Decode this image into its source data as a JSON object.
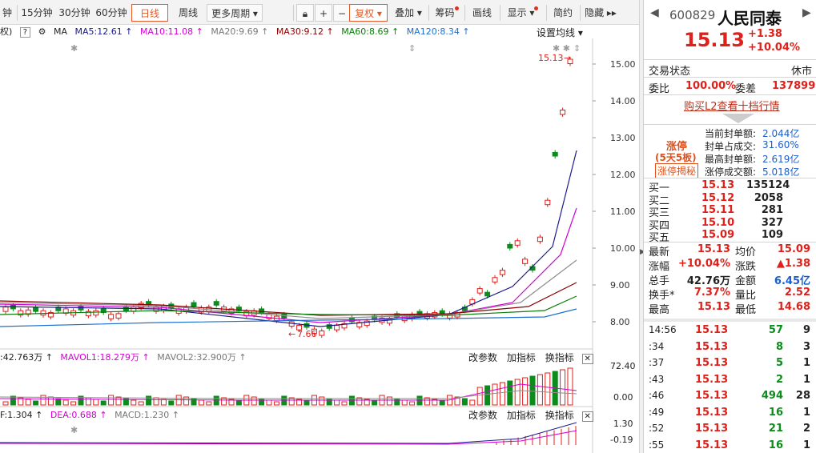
{
  "toolbar": {
    "items": [
      "钟",
      "15分钟",
      "30分钟",
      "60分钟",
      "日线",
      "周线",
      "更多周期 ▾"
    ],
    "icons": [
      "lock-icon",
      "zoom-in-icon",
      "zoom-out-icon"
    ],
    "right_items": [
      "复权 ▾",
      "叠加 ▾",
      "筹码",
      "画线",
      "显示 ▾",
      "简约",
      "隐藏 ▸▸"
    ]
  },
  "ma_bar": {
    "prefix": "权)",
    "ma_label": "MA",
    "ma5": "MA5:12.61 ↑",
    "ma10": "MA10:11.08 ↑",
    "ma20": "MA20:9.69 ↑",
    "ma30": "MA30:9.12 ↑",
    "ma60": "MA60:8.69 ↑",
    "ma120": "MA120:8.34 ↑",
    "settings": "设置均线 ▾"
  },
  "price_axis": [
    "15.00",
    "14.00",
    "13.00",
    "12.00",
    "11.00",
    "10.00",
    "9.00",
    "8.00"
  ],
  "annotations": {
    "high": "15.13",
    "low": "7.66"
  },
  "vol_bar": {
    "v1": ":42.763万 ↑",
    "mavol1": "MAVOL1:18.279万 ↑",
    "mavol2": "MAVOL2:32.900万 ↑",
    "btn1": "改参数",
    "btn2": "加指标",
    "btn3": "换指标",
    "axis_top": "72.40",
    "axis_bottom": "0.00"
  },
  "macd_bar": {
    "dif": "F:1.304 ↑",
    "dea": "DEA:0.688 ↑",
    "macd": "MACD:1.230 ↑",
    "btn1": "改参数",
    "btn2": "加指标",
    "btn3": "换指标",
    "axis_top": "1.30",
    "axis_bottom": "-0.19"
  },
  "colors": {
    "ma5": "#1a1a8c",
    "ma10": "#d400d4",
    "ma20": "#8e8e8e",
    "ma30": "#8b0000",
    "ma60": "#0a7d0a",
    "ma120": "#1e6ed0",
    "up": "#e0201b",
    "down": "#0b8c1b"
  },
  "quote": {
    "code": "600829",
    "name": "人民同泰",
    "price": "15.13",
    "change": "+1.38",
    "change_pct": "+10.04%",
    "status_label": "交易状态",
    "status_value": "休市",
    "weibi_label": "委比",
    "weibi_value": "100.00%",
    "weicha_label": "委差",
    "weicha_value": "137899",
    "l2_link": "购买L2查看十档行情",
    "limit_title": "涨停",
    "limit_days": "(5天5板)",
    "limit_btn": "涨停揭秘",
    "limit_stats": [
      {
        "label": "当前封单额:",
        "value": "2.044亿"
      },
      {
        "label": "封单占成交:",
        "value": "31.60%"
      },
      {
        "label": "最高封单额:",
        "value": "2.619亿"
      },
      {
        "label": "涨停成交额:",
        "value": "5.018亿"
      }
    ],
    "bids": [
      {
        "label": "买一",
        "price": "15.13",
        "vol": "135124"
      },
      {
        "label": "买二",
        "price": "15.12",
        "vol": "2058"
      },
      {
        "label": "买三",
        "price": "15.11",
        "vol": "281"
      },
      {
        "label": "买四",
        "price": "15.10",
        "vol": "327"
      },
      {
        "label": "买五",
        "price": "15.09",
        "vol": "109"
      }
    ],
    "stats": [
      {
        "l1": "最新",
        "v1": "15.13",
        "l2": "均价",
        "v2": "15.09"
      },
      {
        "l1": "涨幅",
        "v1": "+10.04%",
        "l2": "涨跌",
        "v2": "▲1.38"
      },
      {
        "l1": "总手",
        "v1": "42.76万",
        "l2": "金额",
        "v2": "6.45亿"
      },
      {
        "l1": "换手*",
        "v1": "7.37%",
        "l2": "量比",
        "v2": "2.52"
      },
      {
        "l1": "最高",
        "v1": "15.13",
        "l2": "最低",
        "v2": "14.68"
      }
    ],
    "ticks": [
      {
        "t": "14:56",
        "p": "15.13",
        "v": "57",
        "n": "9"
      },
      {
        "t": ":34",
        "p": "15.13",
        "v": "8",
        "n": "3"
      },
      {
        "t": ":37",
        "p": "15.13",
        "v": "5",
        "n": "1"
      },
      {
        "t": ":43",
        "p": "15.13",
        "v": "2",
        "n": "1"
      },
      {
        "t": ":46",
        "p": "15.13",
        "v": "494",
        "n": "28"
      },
      {
        "t": ":49",
        "p": "15.13",
        "v": "16",
        "n": "1"
      },
      {
        "t": ":52",
        "p": "15.13",
        "v": "21",
        "n": "2"
      },
      {
        "t": ":55",
        "p": "15.13",
        "v": "16",
        "n": "1"
      }
    ]
  }
}
